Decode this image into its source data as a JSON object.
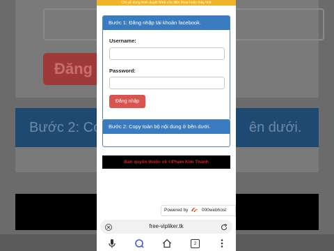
{
  "background": {
    "login_button_fragment": "Đăng nhập",
    "step2_fragment": "Bước 2: Cop",
    "step2_fragment_right": "ên dưới.",
    "footer_fragment": "Bản quy                                   Thành"
  },
  "notice": {
    "text": "Chỉ sử dụng trình duyệt Web của điện thoại hoặc máy tính"
  },
  "step1": {
    "heading": "Bước 1: Đăng nhập tài khoản facebook.",
    "username_label": "Username:",
    "username_value": "",
    "password_label": "Password:",
    "password_value": "",
    "login_label": "Đăng nhập"
  },
  "step2": {
    "heading": "Bước 2: Copy toàn bộ nội dung ở bên dưới."
  },
  "footer": {
    "copyright": "Bản quyền thuộc về ©Phạm Kim Thành"
  },
  "badge": {
    "powered_label": "Powered by",
    "brand": "000webhost"
  },
  "browser": {
    "url": "free-vipliker.tk",
    "tab_count": "2",
    "icons": [
      "site-settings-icon",
      "refresh-icon",
      "microphone-icon",
      "search-icon",
      "home-icon",
      "tabs-icon",
      "more-icon"
    ]
  },
  "colors": {
    "panel_header": "#3a7bbf",
    "login_button": "#d9534f",
    "notice_bar": "#f0b429",
    "copyright_text": "#d32020"
  }
}
